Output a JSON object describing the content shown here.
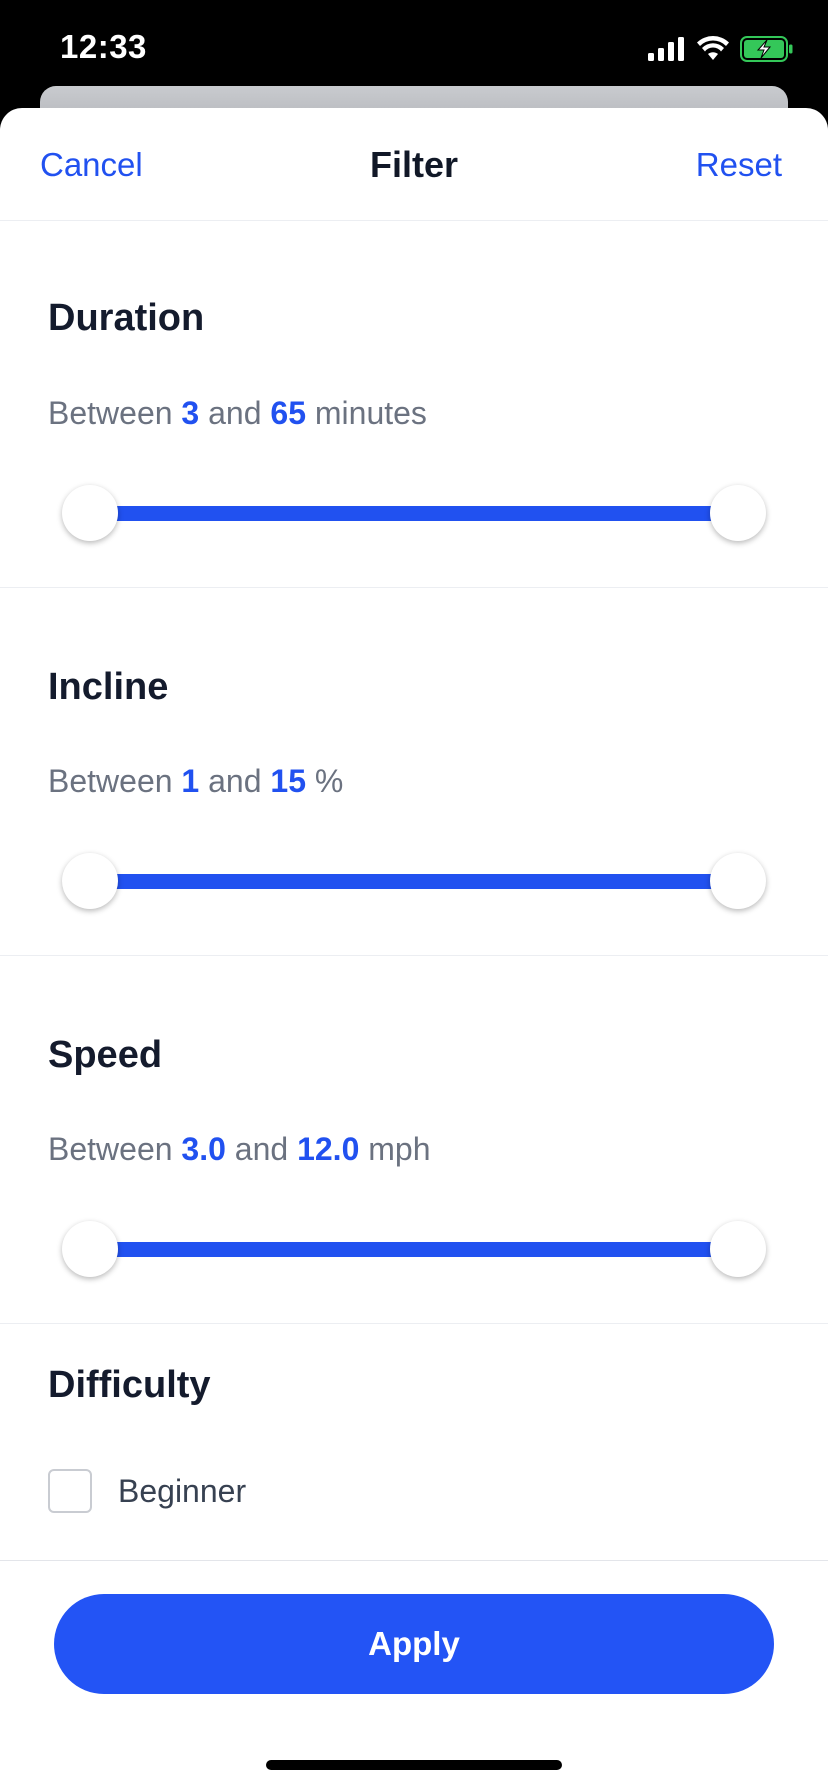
{
  "status_bar": {
    "time": "12:33",
    "icons": [
      "cellular-signal-icon",
      "wifi-icon",
      "battery-charging-icon"
    ]
  },
  "nav": {
    "cancel_label": "Cancel",
    "title": "Filter",
    "reset_label": "Reset"
  },
  "sections": {
    "duration": {
      "title": "Duration",
      "prefix": "Between",
      "min": "3",
      "joiner": "and",
      "max": "65",
      "unit": "minutes",
      "slider_min_fraction": 0,
      "slider_max_fraction": 1
    },
    "incline": {
      "title": "Incline",
      "prefix": "Between",
      "min": "1",
      "joiner": "and",
      "max": "15",
      "unit": "%",
      "slider_min_fraction": 0,
      "slider_max_fraction": 1
    },
    "speed": {
      "title": "Speed",
      "prefix": "Between",
      "min": "3.0",
      "joiner": "and",
      "max": "12.0",
      "unit": "mph",
      "slider_min_fraction": 0,
      "slider_max_fraction": 1
    },
    "difficulty": {
      "title": "Difficulty",
      "options": [
        {
          "label": "Beginner",
          "checked": false
        }
      ]
    }
  },
  "footer": {
    "apply_label": "Apply"
  },
  "colors": {
    "accent": "#2151f0",
    "button": "#2354f5",
    "heading": "#141b2d",
    "muted_text": "#6b7280",
    "divider": "#eceef2",
    "battery_green": "#34c759"
  }
}
